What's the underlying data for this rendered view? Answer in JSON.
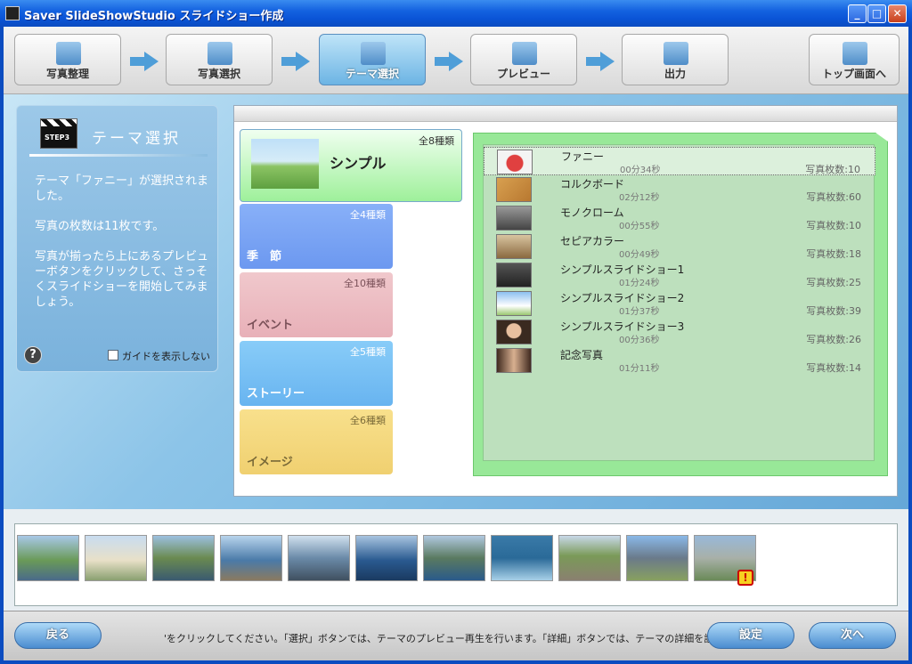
{
  "window": {
    "title": "Saver SlideShowStudio  スライドショー作成"
  },
  "steps": [
    {
      "label": "写真整理",
      "icon": "photo-organize-icon"
    },
    {
      "label": "写真選択",
      "icon": "photo-select-icon"
    },
    {
      "label": "テーマ選択",
      "icon": "theme-select-icon",
      "active": true
    },
    {
      "label": "プレビュー",
      "icon": "preview-icon"
    },
    {
      "label": "出力",
      "icon": "output-icon"
    },
    {
      "label": "トップ画面へ",
      "icon": "top-screen-icon"
    }
  ],
  "guide": {
    "step_badge": "STEP3",
    "title": "テーマ選択",
    "text1": "テーマ「ファニー」が選択されました。",
    "text2": "写真の枚数は11枚です。",
    "text3": "写真が揃ったら上にあるプレビューボタンをクリックして、さっそくスライドショーを開始してみましょう。",
    "help": "?",
    "hide_guide": "ガイドを表示しない"
  },
  "categories": {
    "simple": {
      "name": "シンプル",
      "count": "全8種類"
    },
    "season": {
      "name": "季　節",
      "count": "全4種類"
    },
    "event": {
      "name": "イベント",
      "count": "全10種類"
    },
    "story": {
      "name": "ストーリー",
      "count": "全5種類"
    },
    "image": {
      "name": "イメージ",
      "count": "全6種類"
    }
  },
  "themes": [
    {
      "name": "ファニー",
      "duration": "00分34秒",
      "count": "写真枚数:10",
      "selected": true
    },
    {
      "name": "コルクボード",
      "duration": "02分12秒",
      "count": "写真枚数:60"
    },
    {
      "name": "モノクローム",
      "duration": "00分55秒",
      "count": "写真枚数:10"
    },
    {
      "name": "セピアカラー",
      "duration": "00分49秒",
      "count": "写真枚数:18"
    },
    {
      "name": "シンプルスライドショー1",
      "duration": "01分24秒",
      "count": "写真枚数:25"
    },
    {
      "name": "シンプルスライドショー2",
      "duration": "01分37秒",
      "count": "写真枚数:39"
    },
    {
      "name": "シンプルスライドショー3",
      "duration": "00分36秒",
      "count": "写真枚数:26"
    },
    {
      "name": "記念写真",
      "duration": "01分11秒",
      "count": "写真枚数:14"
    }
  ],
  "photos_count": 11,
  "warning_icon": "!",
  "bottom": {
    "back": "戻る",
    "hint": "'をクリックしてください。「選択」ボタンでは、テーマのプレビュー再生を行います。「詳細」ボタンでは、テーマの詳細を設定で",
    "settings": "設定",
    "next": "次へ"
  },
  "colors": {
    "titlebar": "#0a54d6",
    "accent": "#4a8cd0",
    "theme_panel": "#98e898"
  }
}
